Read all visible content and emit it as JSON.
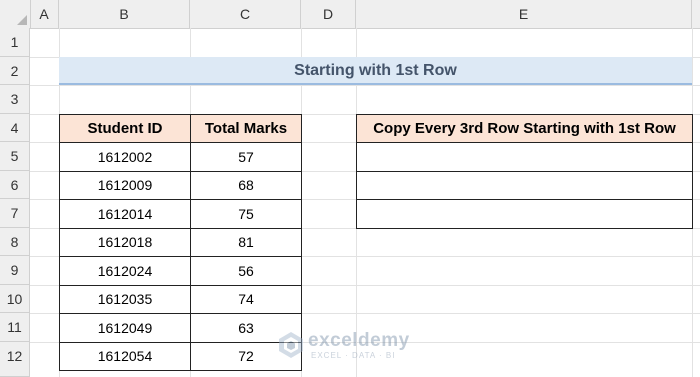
{
  "columns": [
    "A",
    "B",
    "C",
    "D",
    "E"
  ],
  "rows": [
    "1",
    "2",
    "3",
    "4",
    "5",
    "6",
    "7",
    "8",
    "9",
    "10",
    "11",
    "12"
  ],
  "title": "Starting with 1st Row",
  "source_table": {
    "headers": [
      "Student ID",
      "Total Marks"
    ],
    "rows": [
      [
        "1612002",
        "57"
      ],
      [
        "1612009",
        "68"
      ],
      [
        "1612014",
        "75"
      ],
      [
        "1612018",
        "81"
      ],
      [
        "1612024",
        "56"
      ],
      [
        "1612035",
        "74"
      ],
      [
        "1612049",
        "63"
      ],
      [
        "1612054",
        "72"
      ]
    ]
  },
  "result_table": {
    "header": "Copy Every 3rd Row Starting with 1st Row",
    "rows": [
      "",
      "",
      ""
    ]
  },
  "watermark": {
    "name": "exceldemy",
    "tagline": "EXCEL · DATA · BI"
  },
  "colors": {
    "header_fill": "#fce4d6",
    "banner_fill": "#dde9f5",
    "banner_text": "#44546a"
  }
}
